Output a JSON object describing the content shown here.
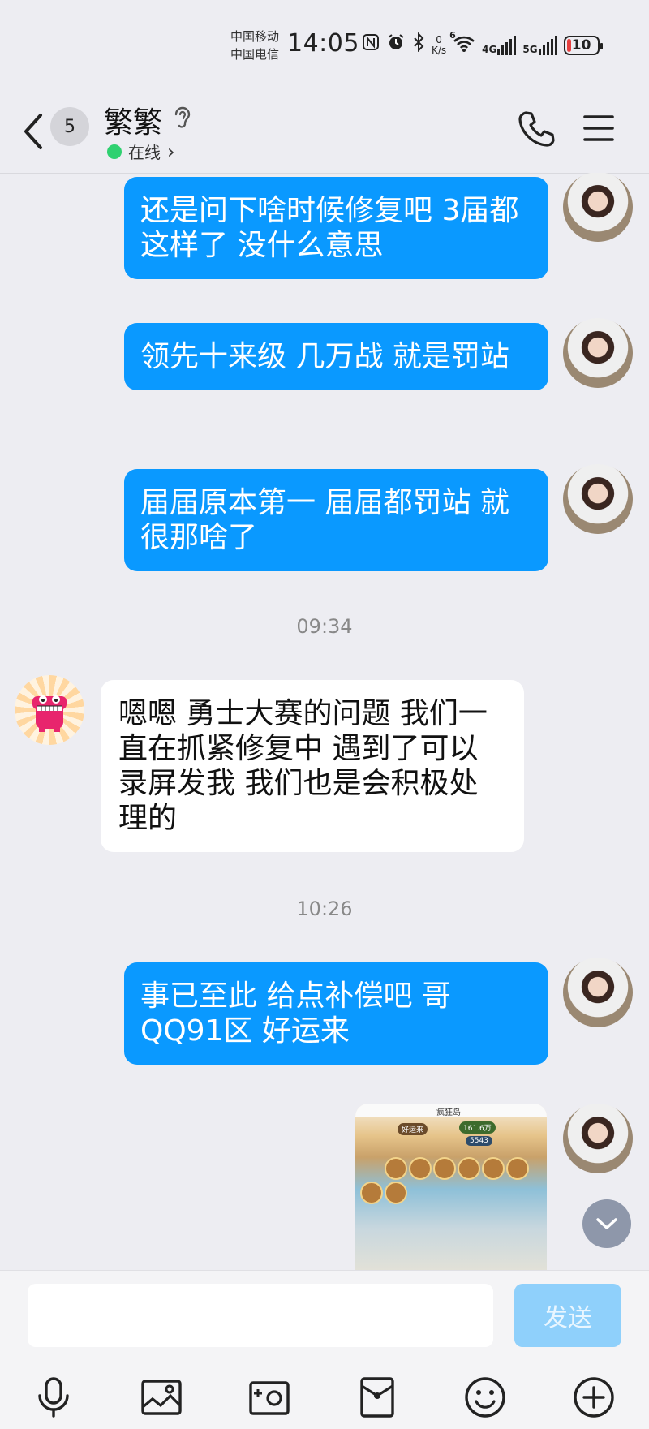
{
  "status_bar": {
    "carrier_1": "中国移动",
    "carrier_2": "中国电信",
    "time": "14:05",
    "speed_value": "0",
    "speed_unit": "K/s",
    "net_1": "4G",
    "net_2": "5G",
    "wifi_label": "6",
    "battery": "10"
  },
  "header": {
    "unread_count": "5",
    "contact_name": "繁繁",
    "presence": "在线",
    "presence_arrow": "›"
  },
  "messages": [
    {
      "side": "right",
      "text": "还是问下啥时候修复吧 3届都这样了   没什么意思"
    },
    {
      "side": "right",
      "text": "领先十来级  几万战  就是罚站"
    },
    {
      "side": "right",
      "text": "届届原本第一 届届都罚站 就很那啥了"
    },
    {
      "timestamp": "09:34"
    },
    {
      "side": "left",
      "text": "嗯嗯  勇士大赛的问题  我们一直在抓紧修复中  遇到了可以录屏发我  我们也是会积极处理的"
    },
    {
      "timestamp": "10:26"
    },
    {
      "side": "right",
      "text": "事已至此 给点补偿吧 哥 QQ91区  好运来"
    },
    {
      "side": "right",
      "type": "image"
    }
  ],
  "image_message": {
    "game_title": "疯狂岛",
    "player_name": "好运来",
    "stat_1": "161.6万",
    "stat_2": "5543"
  },
  "input": {
    "placeholder": "",
    "send_label": "发送"
  },
  "toolbar": [
    "mic-icon",
    "image-icon",
    "camera-icon",
    "red-packet-icon",
    "emoji-icon",
    "plus-icon"
  ]
}
